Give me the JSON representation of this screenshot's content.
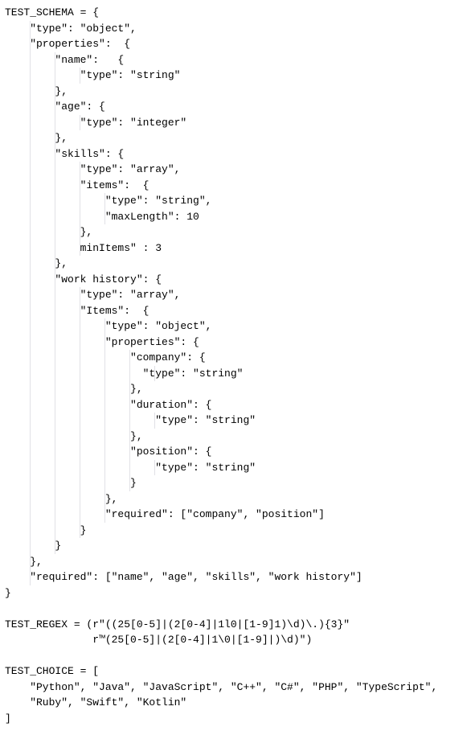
{
  "code": {
    "lines": [
      {
        "text": "TEST_SCHEMA = {",
        "indent": 0
      },
      {
        "text": "    \"type\": \"object\",",
        "indent": 1
      },
      {
        "text": "    \"properties\":  {",
        "indent": 1
      },
      {
        "text": "        \"name\":   {",
        "indent": 2
      },
      {
        "text": "            \"type\": \"string\"",
        "indent": 3
      },
      {
        "text": "        },",
        "indent": 2
      },
      {
        "text": "        \"age\": {",
        "indent": 2
      },
      {
        "text": "            \"type\": \"integer\"",
        "indent": 3
      },
      {
        "text": "        },",
        "indent": 2
      },
      {
        "text": "        \"skills\": {",
        "indent": 2
      },
      {
        "text": "            \"type\": \"array\",",
        "indent": 3
      },
      {
        "text": "            \"items\":  {",
        "indent": 3
      },
      {
        "text": "                \"type\": \"string\",",
        "indent": 4
      },
      {
        "text": "                \"maxLength\": 10",
        "indent": 4
      },
      {
        "text": "            },",
        "indent": 3
      },
      {
        "text": "            minItems\" : 3",
        "indent": 3
      },
      {
        "text": "        },",
        "indent": 2
      },
      {
        "text": "        \"work history\": {",
        "indent": 2
      },
      {
        "text": "            \"type\": \"array\",",
        "indent": 3
      },
      {
        "text": "            \"Items\":  {",
        "indent": 3
      },
      {
        "text": "                \"type\": \"object\",",
        "indent": 4
      },
      {
        "text": "                \"properties\": {",
        "indent": 4
      },
      {
        "text": "                    \"company\": {",
        "indent": 5
      },
      {
        "text": "                      \"type\": \"string\"",
        "indent": 6
      },
      {
        "text": "                    },",
        "indent": 5
      },
      {
        "text": "                    \"duration\": {",
        "indent": 5
      },
      {
        "text": "                        \"type\": \"string\"",
        "indent": 6
      },
      {
        "text": "                    },",
        "indent": 5
      },
      {
        "text": "                    \"position\": {",
        "indent": 5
      },
      {
        "text": "                        \"type\": \"string\"",
        "indent": 6
      },
      {
        "text": "                    }",
        "indent": 5
      },
      {
        "text": "                },",
        "indent": 4
      },
      {
        "text": "                \"required\": [\"company\", \"position\"]",
        "indent": 4
      },
      {
        "text": "            }",
        "indent": 3
      },
      {
        "text": "        }",
        "indent": 2
      },
      {
        "text": "    },",
        "indent": 1
      },
      {
        "text": "    \"required\": [\"name\", \"age\", \"skills\", \"work history\"]",
        "indent": 1
      },
      {
        "text": "}",
        "indent": 0
      },
      {
        "text": "",
        "indent": 0
      },
      {
        "text": "TEST_REGEX = (r\"((25[0-5]|(2[0-4]|1l0|[1-9]1)\\d)\\.){3}\"",
        "indent": 0
      },
      {
        "text": "              r™(25[0-5]|(2[0-4]|1\\0|[1-9]|)\\d)\")",
        "indent": 0
      },
      {
        "text": "",
        "indent": 0
      },
      {
        "text": "TEST_CHOICE = [",
        "indent": 0
      },
      {
        "text": "    \"Python\", \"Java\", \"JavaScript\", \"C++\", \"C#\", \"PHP\", \"TypeScript\",",
        "indent": 0
      },
      {
        "text": "    \"Ruby\", \"Swift\", \"Kotlin\"",
        "indent": 0
      },
      {
        "text": "]",
        "indent": 0
      }
    ]
  },
  "schema_data": {
    "TEST_SCHEMA": {
      "type": "object",
      "properties": {
        "name": {
          "type": "string"
        },
        "age": {
          "type": "integer"
        },
        "skills": {
          "type": "array",
          "items": {
            "type": "string",
            "maxLength": 10
          },
          "minItems": 3
        },
        "work history": {
          "type": "array",
          "Items": {
            "type": "object",
            "properties": {
              "company": {
                "type": "string"
              },
              "duration": {
                "type": "string"
              },
              "position": {
                "type": "string"
              }
            },
            "required": [
              "company",
              "position"
            ]
          }
        }
      },
      "required": [
        "name",
        "age",
        "skills",
        "work history"
      ]
    },
    "TEST_REGEX": "((25[0-5]|(2[0-4]|1l0|[1-9]1)\\d)\\.){3}(25[0-5]|(2[0-4]|1\\0|[1-9]|)\\d)",
    "TEST_CHOICE": [
      "Python",
      "Java",
      "JavaScript",
      "C++",
      "C#",
      "PHP",
      "TypeScript",
      "Ruby",
      "Swift",
      "Kotlin"
    ]
  }
}
